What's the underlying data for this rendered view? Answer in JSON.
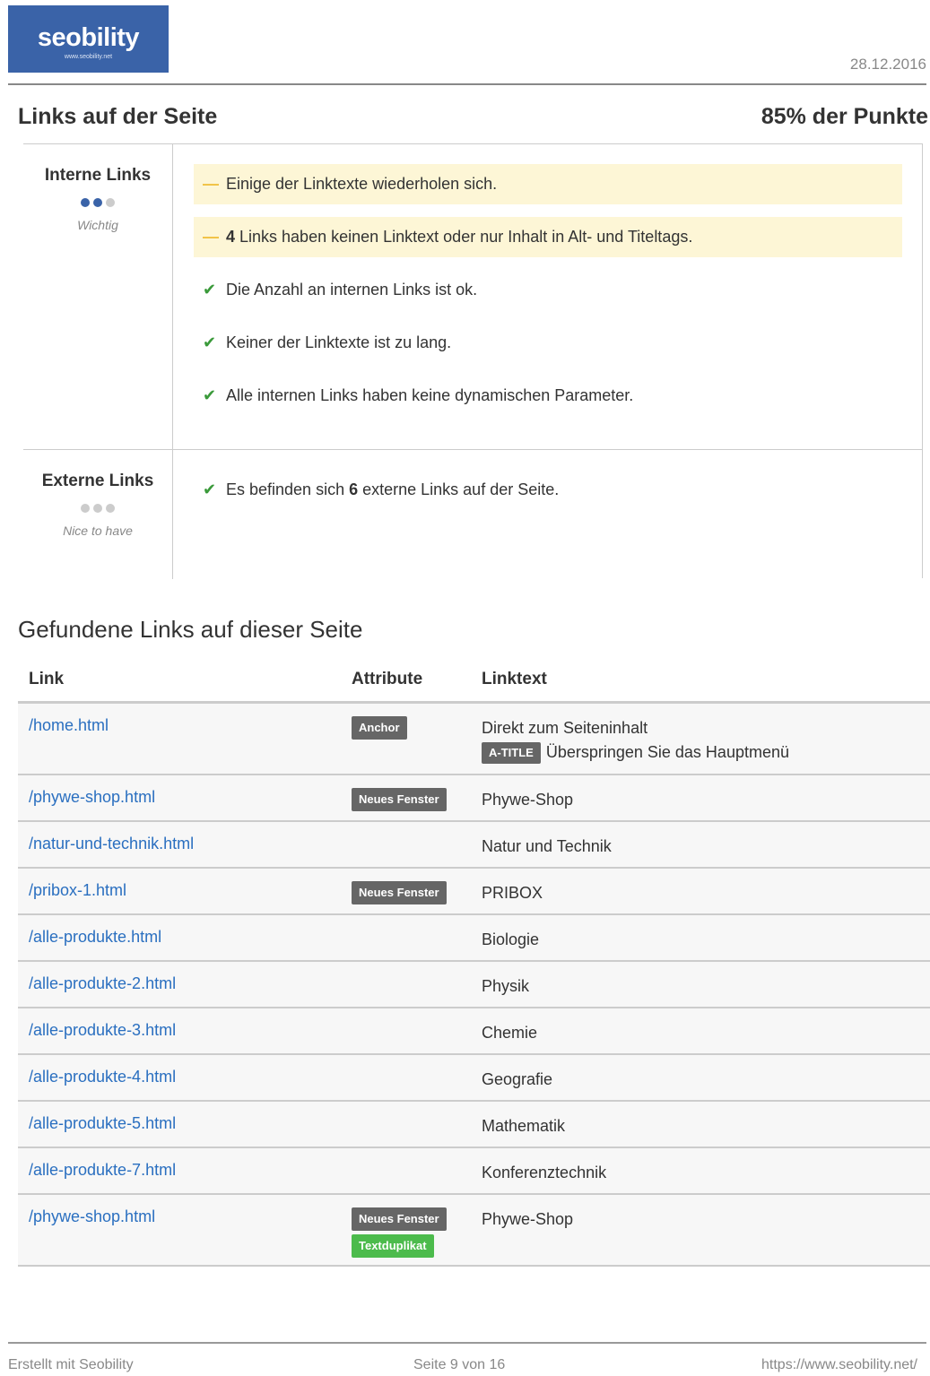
{
  "header": {
    "logo": "seobility",
    "logo_sub": "www.seobility.net",
    "date": "28.12.2016"
  },
  "section": {
    "title": "Links auf der Seite",
    "score": "85% der Punkte"
  },
  "categories": [
    {
      "title": "Interne Links",
      "importance": "Wichtig",
      "dots_filled": 2,
      "dots_total": 3,
      "messages": [
        {
          "kind": "warn",
          "pre": "",
          "bold": "",
          "text": "Einige der Linktexte wiederholen sich."
        },
        {
          "kind": "warn",
          "pre": "",
          "bold": "4",
          "text": " Links haben keinen Linktext oder nur Inhalt in Alt- und Titeltags."
        },
        {
          "kind": "ok",
          "pre": "",
          "bold": "",
          "text": "Die Anzahl an internen Links ist ok."
        },
        {
          "kind": "ok",
          "pre": "",
          "bold": "",
          "text": "Keiner der Linktexte ist zu lang."
        },
        {
          "kind": "ok",
          "pre": "",
          "bold": "",
          "text": "Alle internen Links haben keine dynamischen Parameter."
        }
      ]
    },
    {
      "title": "Externe Links",
      "importance": "Nice to have",
      "dots_filled": 0,
      "dots_total": 3,
      "messages": [
        {
          "kind": "ok",
          "pre": "Es befinden sich ",
          "bold": "6",
          "text": " externe Links auf der Seite."
        }
      ]
    }
  ],
  "links": {
    "title": "Gefundene Links auf dieser Seite",
    "columns": {
      "link": "Link",
      "attribute": "Attribute",
      "linktext": "Linktext"
    },
    "rows": [
      {
        "link": "/home.html",
        "badges": [
          "Anchor"
        ],
        "green_badges": [],
        "text": "Direkt zum Seiteninhalt",
        "title_badge": "A-TITLE",
        "title_text": "Überspringen Sie das Hauptmenü"
      },
      {
        "link": "/phywe-shop.html",
        "badges": [
          "Neues Fenster"
        ],
        "green_badges": [],
        "text": "Phywe-Shop"
      },
      {
        "link": "/natur-und-technik.html",
        "badges": [],
        "green_badges": [],
        "text": "Natur und Technik"
      },
      {
        "link": "/pribox-1.html",
        "badges": [
          "Neues Fenster"
        ],
        "green_badges": [],
        "text": "PRIBOX"
      },
      {
        "link": "/alle-produkte.html",
        "badges": [],
        "green_badges": [],
        "text": "Biologie"
      },
      {
        "link": "/alle-produkte-2.html",
        "badges": [],
        "green_badges": [],
        "text": "Physik"
      },
      {
        "link": "/alle-produkte-3.html",
        "badges": [],
        "green_badges": [],
        "text": "Chemie"
      },
      {
        "link": "/alle-produkte-4.html",
        "badges": [],
        "green_badges": [],
        "text": "Geografie"
      },
      {
        "link": "/alle-produkte-5.html",
        "badges": [],
        "green_badges": [],
        "text": "Mathematik"
      },
      {
        "link": "/alle-produkte-7.html",
        "badges": [],
        "green_badges": [],
        "text": "Konferenztechnik"
      },
      {
        "link": "/phywe-shop.html",
        "badges": [
          "Neues Fenster"
        ],
        "green_badges": [
          "Textduplikat"
        ],
        "text": "Phywe-Shop"
      }
    ]
  },
  "footer": {
    "left": "Erstellt mit Seobility",
    "center": "Seite 9 von 16",
    "right": "https://www.seobility.net/"
  },
  "colors": {
    "brand": "#3a63a8",
    "link": "#2a6fc0",
    "warn_bg": "#fdf6d6",
    "ok": "#3a9a3a",
    "badge": "#666666",
    "badge_green": "#4cbb4c"
  }
}
